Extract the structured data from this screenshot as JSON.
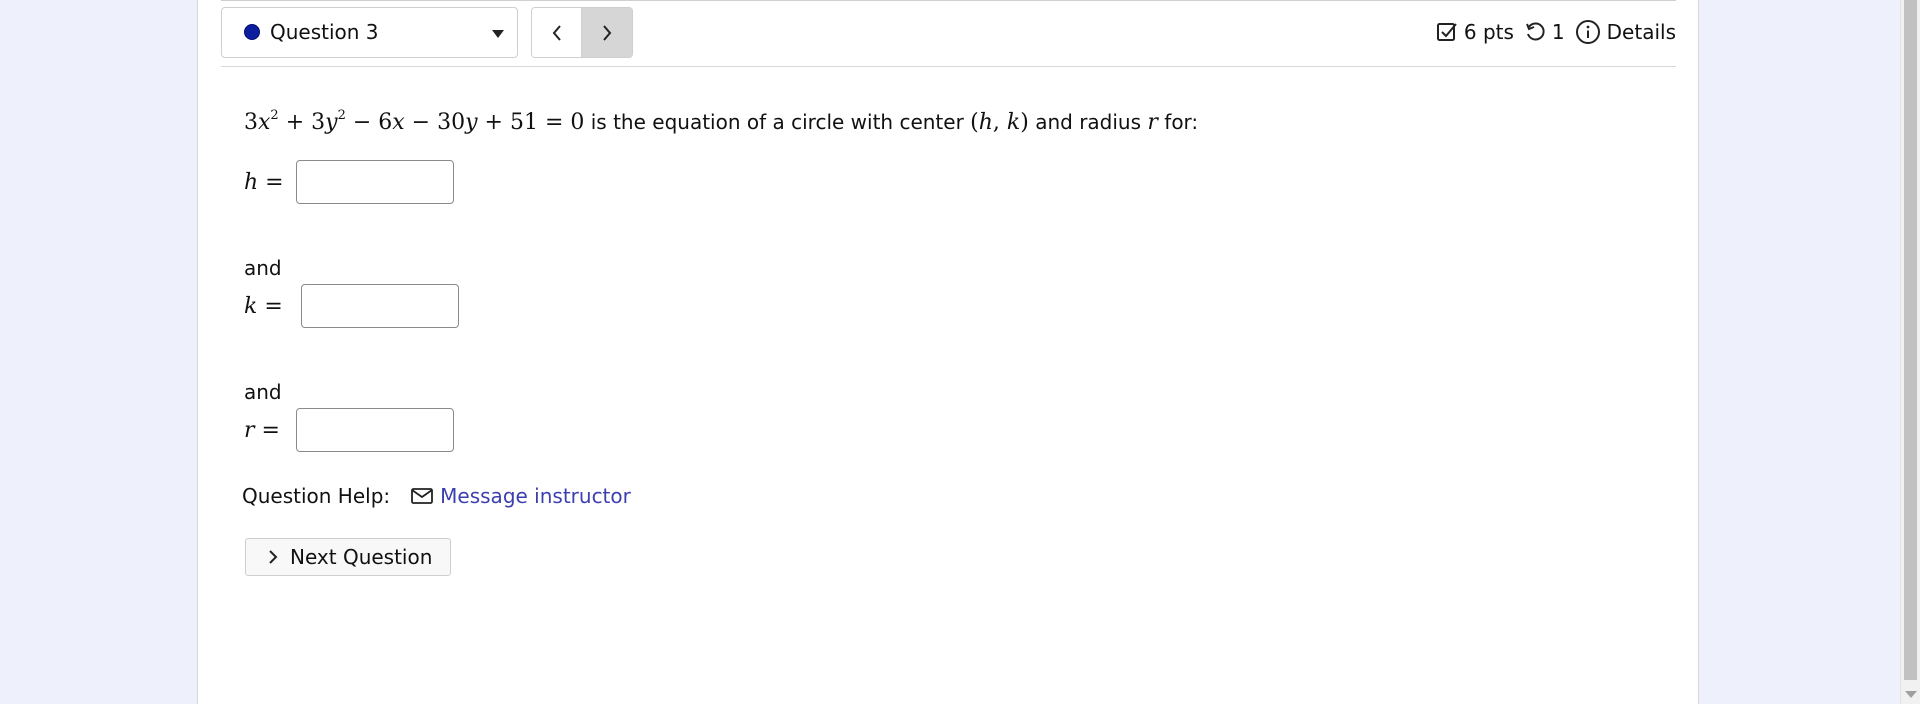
{
  "header": {
    "question_label": "Question 3",
    "points": "6 pts",
    "attempts": "1",
    "details": "Details"
  },
  "problem": {
    "statement_mid": "is the equation of a circle with center",
    "statement_and": "and radius",
    "statement_end": "for:"
  },
  "answers": {
    "h_label": "h =",
    "k_label": "k =",
    "r_label": "r =",
    "and_1": "and",
    "and_2": "and",
    "h_value": "",
    "k_value": "",
    "r_value": ""
  },
  "help": {
    "label": "Question Help:",
    "message_link": "Message instructor"
  },
  "next_button": "Next Question",
  "colors": {
    "status_dot": "#0b1ea0",
    "link": "#3c3fb0",
    "background": "#eef0fb"
  }
}
